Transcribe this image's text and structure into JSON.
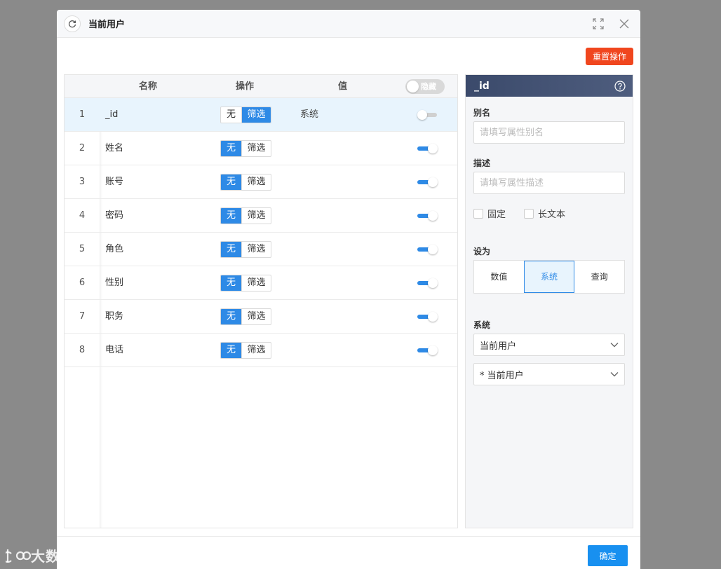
{
  "modal": {
    "title": "当前用户",
    "reset_label": "重置操作",
    "ok_label": "确定"
  },
  "table": {
    "headers": {
      "name": "名称",
      "action": "操作",
      "value": "值"
    },
    "hide_toggle_label": "隐藏",
    "seg_none_label": "无",
    "seg_filter_label": "筛选",
    "rows": [
      {
        "index": "1",
        "name": "_id",
        "value": "系统"
      },
      {
        "index": "2",
        "name": "姓名",
        "value": ""
      },
      {
        "index": "3",
        "name": "账号",
        "value": ""
      },
      {
        "index": "4",
        "name": "密码",
        "value": ""
      },
      {
        "index": "5",
        "name": "角色",
        "value": ""
      },
      {
        "index": "6",
        "name": "性别",
        "value": ""
      },
      {
        "index": "7",
        "name": "职务",
        "value": ""
      },
      {
        "index": "8",
        "name": "电话",
        "value": ""
      }
    ]
  },
  "panel": {
    "title": "_id",
    "alias_label": "别名",
    "alias_placeholder": "请填写属性别名",
    "desc_label": "描述",
    "desc_placeholder": "请填写属性描述",
    "fixed_label": "固定",
    "longtext_label": "长文本",
    "set_as_label": "设为",
    "set_options": [
      "数值",
      "系统",
      "查询"
    ],
    "system_label": "系统",
    "system_select_value": "当前用户",
    "system_select2_value": "* 当前用户"
  },
  "watermark": {
    "text": "大数跨境"
  },
  "colors": {
    "primary": "#2e8ae6",
    "danger": "#f0461e",
    "header_dark": "#3b4a6b"
  }
}
